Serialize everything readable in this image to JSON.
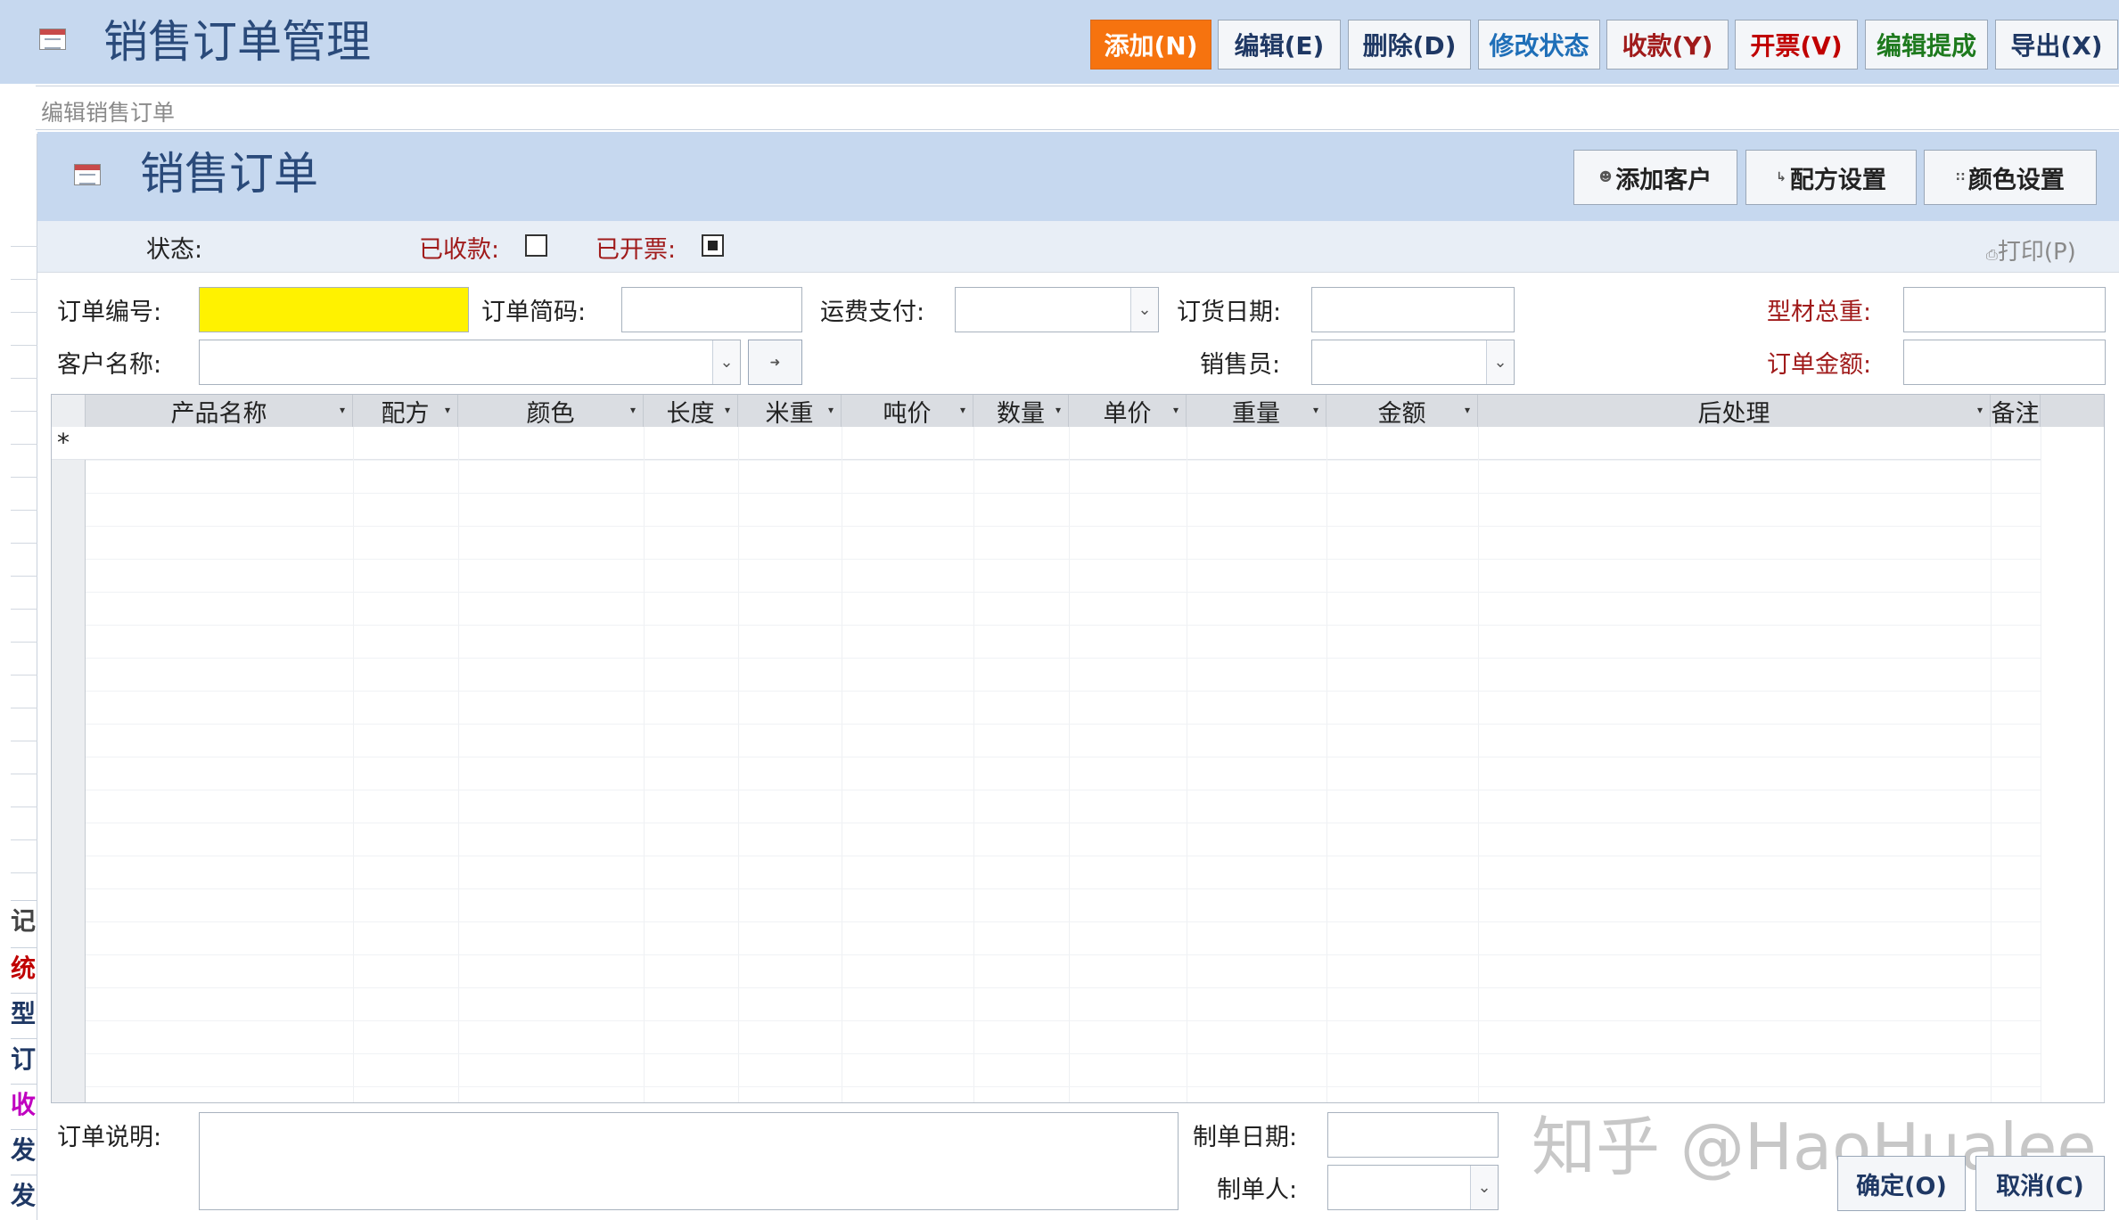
{
  "app": {
    "title": "销售订单管理",
    "toolbar": [
      {
        "label": "添加(N)",
        "color": "#ffffff"
      },
      {
        "label": "编辑(E)",
        "color": "#1f3864"
      },
      {
        "label": "删除(D)",
        "color": "#1f3864"
      },
      {
        "label": "修改状态",
        "color": "#1f6fb8"
      },
      {
        "label": "收款(Y)",
        "color": "#a01b1b"
      },
      {
        "label": "开票(V)",
        "color": "#c00000"
      },
      {
        "label": "编辑提成",
        "color": "#1e7a1e"
      },
      {
        "label": "导出(X)",
        "color": "#1f3864"
      }
    ]
  },
  "tab": {
    "label": "编辑销售订单"
  },
  "left_nav": [
    {
      "label": "记",
      "color": "#444444"
    },
    {
      "label": "统",
      "color": "#c00000"
    },
    {
      "label": "型",
      "color": "#1f3864"
    },
    {
      "label": "订",
      "color": "#1f3864"
    },
    {
      "label": "收",
      "color": "#c000c0"
    },
    {
      "label": "发",
      "color": "#1f3864"
    },
    {
      "label": "发",
      "color": "#1f3864"
    }
  ],
  "form": {
    "title": "销售订单",
    "buttons": {
      "add_customer": "添加客户",
      "recipe_settings": "配方设置",
      "color_settings": "颜色设置"
    },
    "status": {
      "label": "状态:",
      "paid_label": "已收款:",
      "paid_checked": false,
      "invoiced_label": "已开票:",
      "invoiced_checked": true,
      "print_label": "打印(P)"
    },
    "fields": {
      "order_no": {
        "label": "订单编号:",
        "value": ""
      },
      "order_code": {
        "label": "订单简码:",
        "value": ""
      },
      "freight": {
        "label": "运费支付:",
        "value": ""
      },
      "order_date": {
        "label": "订货日期:",
        "value": ""
      },
      "total_weight": {
        "label": "型材总重:",
        "value": ""
      },
      "customer": {
        "label": "客户名称:",
        "value": ""
      },
      "salesperson": {
        "label": "销售员:",
        "value": ""
      },
      "order_amount": {
        "label": "订单金额:",
        "value": ""
      }
    },
    "grid": {
      "columns": [
        "产品名称",
        "配方",
        "颜色",
        "长度",
        "米重",
        "吨价",
        "数量",
        "单价",
        "重量",
        "金额",
        "后处理",
        "备注"
      ],
      "new_row_marker": "*",
      "rows": []
    },
    "footer": {
      "note_label": "订单说明:",
      "note_value": "",
      "created_date_label": "制单日期:",
      "created_date_value": "",
      "creator_label": "制单人:",
      "creator_value": "",
      "confirm_label": "确定(O)",
      "cancel_label": "取消(C)"
    }
  },
  "watermark": "知乎 @HaoHualee"
}
